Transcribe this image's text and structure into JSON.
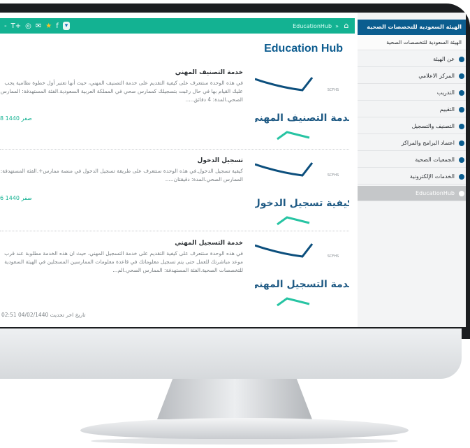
{
  "topbar": {
    "social": [
      "-",
      "T+",
      "◎",
      "✉",
      "★",
      "f",
      "▾"
    ],
    "breadcrumb": "EducationHub",
    "breadcrumb_sep": "»"
  },
  "page": {
    "title": "Education Hub"
  },
  "items": [
    {
      "thumb_title": "خدمة التصنيف المهني",
      "title": "خدمة التصنيف المهني",
      "description": "في هذه الوحدة ستتعرف على كيفية التقديم على خدمة التصنيف المهني، حيث أنها تعتبر أول خطوة نظامية يجب عليك القيام بها في حال رغبت بتسجيلك كممارس صحي في المملكة العربية السعودية.الفئة المستهدفة: الممارس الصحي.المدة: 4 دقائق.....",
      "date": "8 صفر 1440"
    },
    {
      "thumb_title": "كيفية تسجيل الدخول",
      "title": "تسجيل الدخول",
      "description": "كيفية تسجيل الدخول.في هذه الوحدة ستتعرف على طريقة تسجيل الدخول في منصة ممارس+.الفئة المستهدفة: الممارس الصحي.المدة: دقيقتان.....",
      "date": "6 صفر 1440"
    },
    {
      "thumb_title": "خدمة التسجيل المهني",
      "title": "خدمة التسجيل المهني",
      "description": "في هذه الوحدة ستتعرف على كيفية التقديم على خدمة التسجيل المهني، حيث ان هذه الخدمة مطلوبة عند قرب موعد مباشرتك للعمل حتى يتم تسجيل معلوماتك في قاعدة معلومات الممارسين المسجلين في الهيئة السعودية للتخصصات الصحية.الفئة المستهدفة: الممارس الصحي.الم...",
      "date": ""
    }
  ],
  "last_updated": "تاريخ اخر تحديث 04/02/1440 02:51",
  "sidebar": {
    "header": "الهيئة السعودية للتخصصات الصحية",
    "items": [
      "الهيئة السعودية للتخصصات الصحية",
      "عن الهيئة",
      "المركز الاعلامي",
      "التدريب",
      "التقييم",
      "التصنيف والتسجيل",
      "اعتماد البرامج والمراكز",
      "الجمعيات الصحية",
      "الخدمات الإلكترونية",
      "EducationHub"
    ],
    "active_index": 9
  },
  "colors": {
    "green": "#13b292",
    "navy": "#0b5d8f",
    "sidebar_bg": "#f3f4f5"
  }
}
